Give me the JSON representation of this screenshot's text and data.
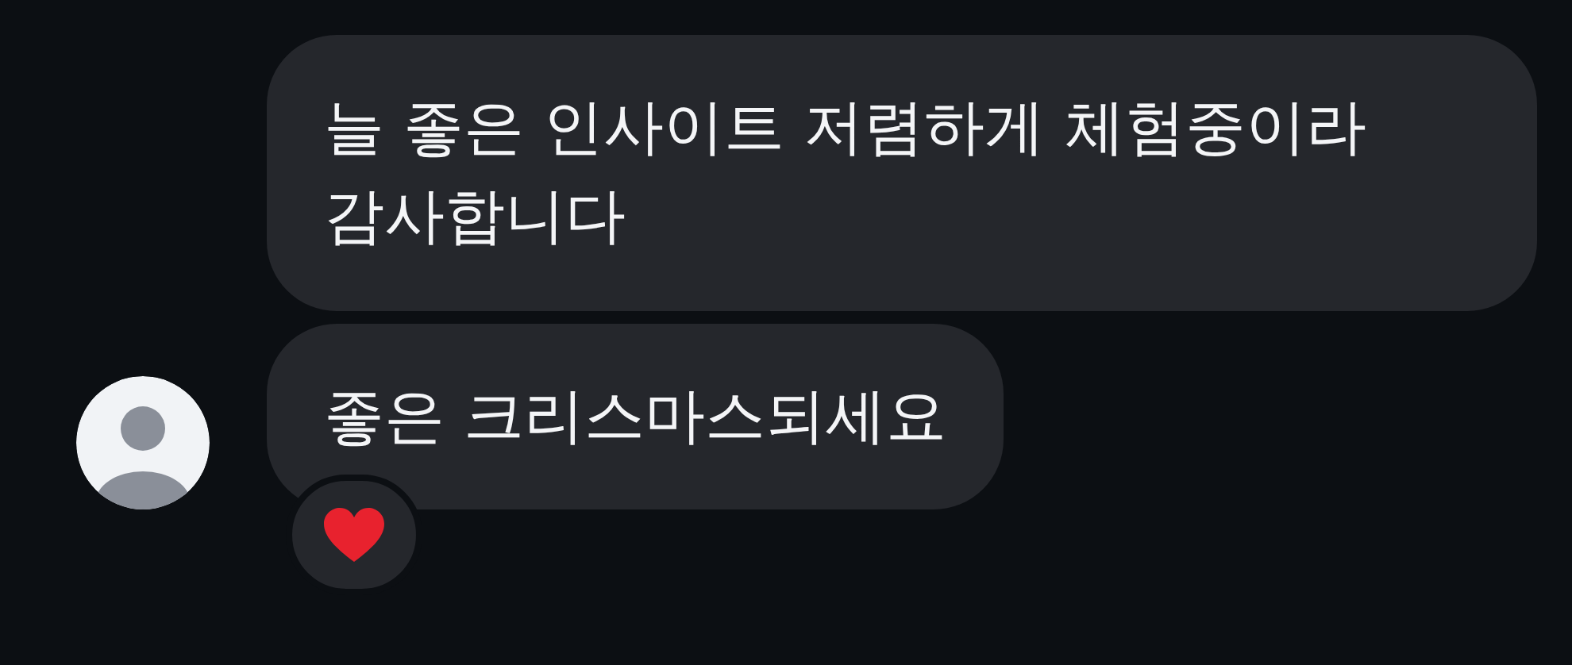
{
  "messages": [
    {
      "text": "늘 좋은 인사이트 저렴하게 체험중이라 감사합니다"
    },
    {
      "text": "좋은 크리스마스되세요",
      "avatar": true,
      "reactions": [
        {
          "kind": "heart"
        }
      ]
    }
  ]
}
